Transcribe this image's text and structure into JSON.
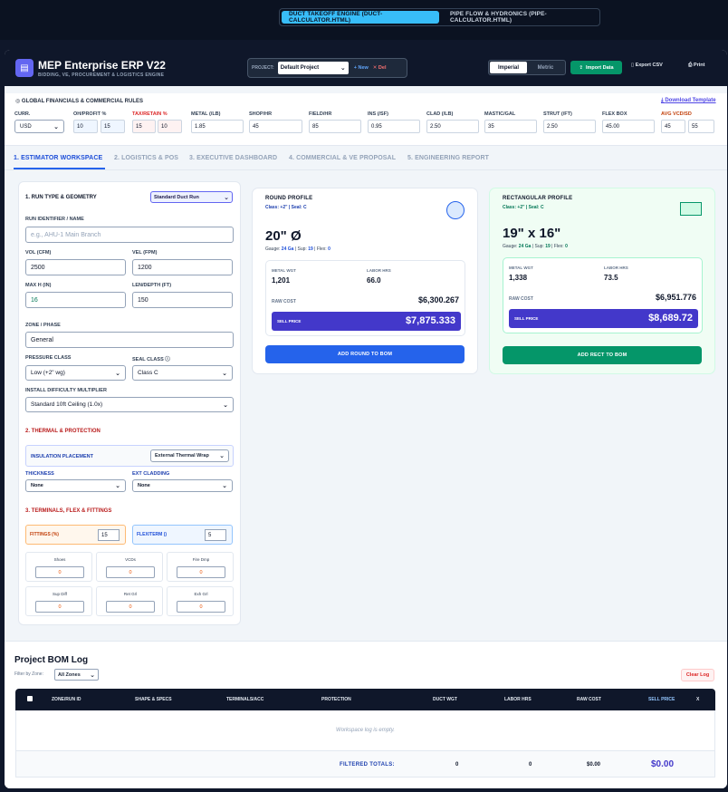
{
  "top_switcher": {
    "active": "DUCT TAKEOFF ENGINE (DUCT-CALCULATOR.HTML)",
    "inactive": "PIPE FLOW & HYDRONICS (PIPE-CALCULATOR.HTML)"
  },
  "header": {
    "title": "MEP Enterprise ERP V22",
    "subtitle": "BIDDING, VE, PROCUREMENT & LOGISTICS ENGINE",
    "project_label": "PROJECT:",
    "project_value": "Default Project",
    "new": "+ New",
    "del": "✕ Del",
    "unit_imperial": "Imperial",
    "unit_metric": "Metric",
    "import": "Import Data",
    "export": "Export CSV",
    "print": "Print"
  },
  "financials": {
    "title": "GLOBAL FINANCIALS & COMMERCIAL RULES",
    "download": "Download Template",
    "fields": [
      {
        "label": "CURR.",
        "value": "USD"
      },
      {
        "label": "OH/PROFIT %",
        "value": "10",
        "value2": "15"
      },
      {
        "label": "TAX/RETAIN %",
        "value": "15",
        "value2": "10"
      },
      {
        "label": "METAL (/LB)",
        "value": "1.85"
      },
      {
        "label": "SHOP/HR",
        "value": "45"
      },
      {
        "label": "FIELD/HR",
        "value": "85"
      },
      {
        "label": "INS (/SF)",
        "value": "0.95"
      },
      {
        "label": "CLAD (/LB)",
        "value": "2.50"
      },
      {
        "label": "MASTIC/GAL",
        "value": "35"
      },
      {
        "label": "STRUT (/FT)",
        "value": "2.50"
      },
      {
        "label": "FLEX BOX",
        "value": "45.00"
      },
      {
        "label": "AVG VCD/SD",
        "value": "45",
        "value2": "55"
      }
    ]
  },
  "tabs": [
    "1. ESTIMATOR WORKSPACE",
    "2. LOGISTICS & POS",
    "3. EXECUTIVE DASHBOARD",
    "4. COMMERCIAL & VE PROPOSAL",
    "5. ENGINEERING REPORT"
  ],
  "form": {
    "sec1": "1. RUN TYPE & GEOMETRY",
    "run_type": "Standard Duct Run",
    "run_id_label": "RUN IDENTIFIER / NAME",
    "run_id_placeholder": "e.g., AHU-1 Main Branch",
    "vol_label": "VOL (CFM)",
    "vol": "2500",
    "vel_label": "VEL (FPM)",
    "vel": "1200",
    "maxh_label": "MAX H (IN)",
    "maxh": "16",
    "len_label": "LEN/DEPTH (FT)",
    "len": "150",
    "zone_label": "ZONE / PHASE",
    "zone": "General",
    "pressure_label": "PRESSURE CLASS",
    "pressure": "Low (+2\" wg)",
    "seal_label": "SEAL CLASS ⓘ",
    "seal": "Class C",
    "difficulty_label": "INSTALL DIFFICULTY MULTIPLIER",
    "difficulty": "Standard 10ft Ceiling (1.0x)",
    "sec2": "2. THERMAL & PROTECTION",
    "ins_label": "INSULATION PLACEMENT",
    "ins": "External Thermal Wrap",
    "thick_label": "THICKNESS",
    "thick": "None",
    "clad_label": "EXT CLADDING",
    "clad": "None",
    "sec3": "3. TERMINALS, FLEX & FITTINGS",
    "fittings_label": "FITTINGS (%)",
    "fittings": "15",
    "flex_label": "FLEX/TERM ()",
    "flex": "5",
    "counts": [
      {
        "label": "Shoes",
        "value": "0"
      },
      {
        "label": "VCDs",
        "value": "0"
      },
      {
        "label": "Fire Dmp",
        "value": "0"
      },
      {
        "label": "Sup Diff",
        "value": "0"
      },
      {
        "label": "Ret Grl",
        "value": "0"
      },
      {
        "label": "Exh Grl",
        "value": "0"
      }
    ]
  },
  "round": {
    "title": "ROUND PROFILE",
    "class": "Class: +2\" | Seal: C",
    "size": "20\" Ø",
    "gauge_pre": "Gauge: ",
    "gauge": "24 Ga",
    "sup_pre": " | Sup: ",
    "sup": "19",
    "flex_pre": " | Flex: ",
    "flex": "0",
    "metal_label": "METAL WGT",
    "metal": "1,201",
    "labor_label": "LABOR HRS",
    "labor": "66.0",
    "raw_label": "RAW COST",
    "raw": "$6,300.267",
    "sell_label": "SELL PRICE",
    "sell": "$7,875.333",
    "button": "ADD ROUND TO BOM"
  },
  "rect": {
    "title": "RECTANGULAR PROFILE",
    "class": "Class: +2\" | Seal: C",
    "size": "19\" x 16\"",
    "gauge_pre": "Gauge: ",
    "gauge": "24 Ga",
    "sup_pre": " | Sup: ",
    "sup": "19",
    "flex_pre": " | Flex: ",
    "flex": "0",
    "metal_label": "METAL WGT",
    "metal": "1,338",
    "labor_label": "LABOR HRS",
    "labor": "73.5",
    "raw_label": "RAW COST",
    "raw": "$6,951.776",
    "sell_label": "SELL PRICE",
    "sell": "$8,689.72",
    "button": "ADD RECT TO BOM"
  },
  "bom": {
    "title": "Project BOM Log",
    "filter_label": "Filter by Zone:",
    "filter": "All Zones",
    "clear": "Clear Log",
    "columns": [
      "ZONE/RUN ID",
      "SHAPE & SPECS",
      "TERMINALS/ACC",
      "PROTECTION",
      "DUCT WGT",
      "LABOR HRS",
      "RAW COST",
      "SELL PRICE",
      "X"
    ],
    "empty": "Workspace log is empty.",
    "totals_label": "FILTERED TOTALS:",
    "tot_wgt": "0",
    "tot_labor": "0",
    "tot_raw": "$0.00",
    "tot_sell": "$0.00"
  }
}
